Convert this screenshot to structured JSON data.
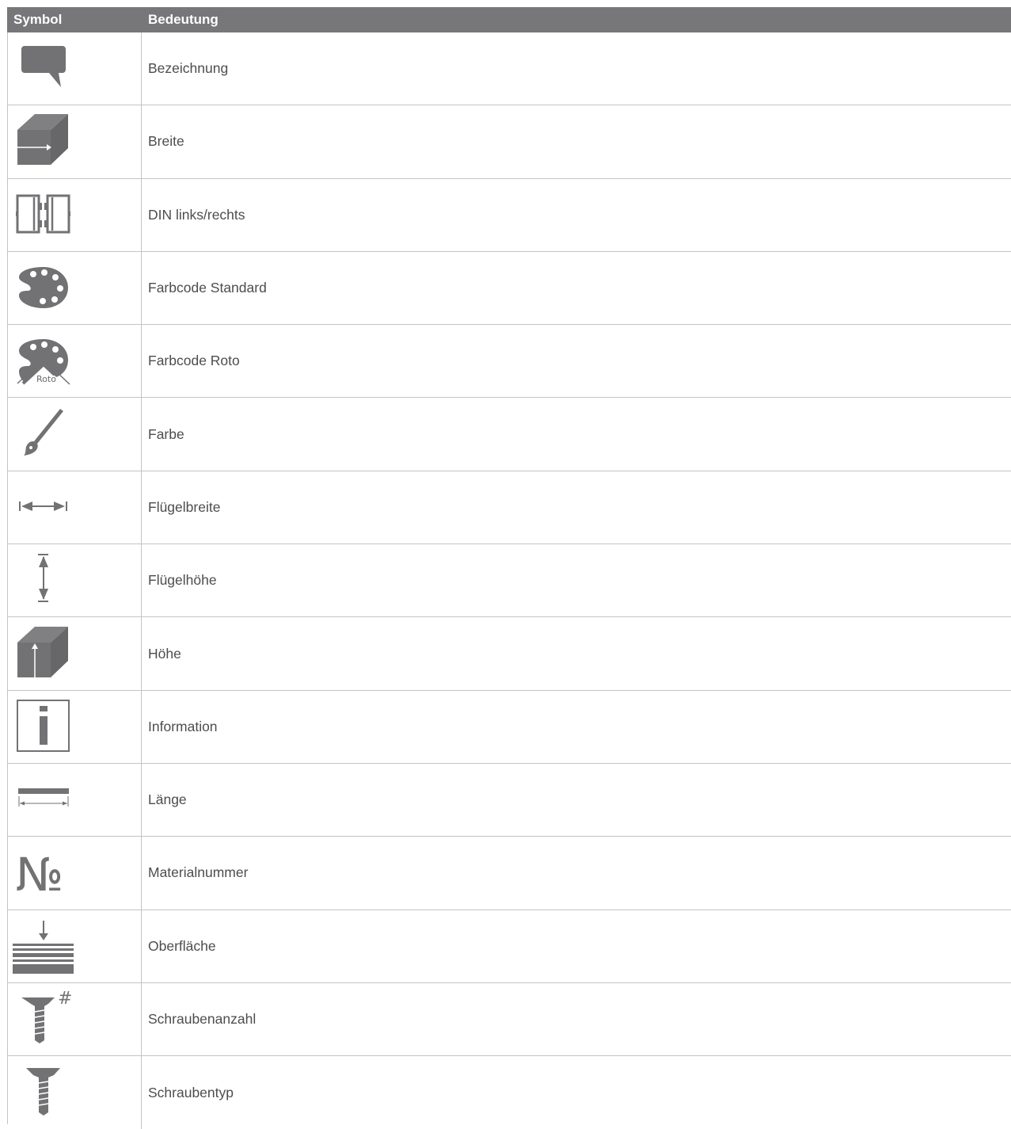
{
  "header": {
    "col_symbol": "Symbol",
    "col_meaning": "Bedeutung"
  },
  "icon_color": "#727275",
  "rows": [
    {
      "icon": "speech-bubble-icon",
      "label": "Bezeichnung"
    },
    {
      "icon": "cube-width-icon",
      "label": "Breite"
    },
    {
      "icon": "din-left-right-icon",
      "label": "DIN links/rechts"
    },
    {
      "icon": "palette-icon",
      "label": "Farbcode Standard"
    },
    {
      "icon": "palette-roto-icon",
      "label": "Farbcode Roto",
      "icon_text": "Roto"
    },
    {
      "icon": "paintbrush-icon",
      "label": "Farbe"
    },
    {
      "icon": "horizontal-arrows-icon",
      "label": "Flügelbreite"
    },
    {
      "icon": "vertical-arrows-icon",
      "label": "Flügelhöhe"
    },
    {
      "icon": "cube-height-icon",
      "label": "Höhe"
    },
    {
      "icon": "info-icon",
      "label": "Information"
    },
    {
      "icon": "length-icon",
      "label": "Länge"
    },
    {
      "icon": "numero-icon",
      "label": "Materialnummer",
      "icon_text": "№"
    },
    {
      "icon": "surface-icon",
      "label": "Oberfläche"
    },
    {
      "icon": "screw-count-icon",
      "label": "Schraubenanzahl",
      "icon_text": "#"
    },
    {
      "icon": "screw-type-icon",
      "label": "Schraubentyp"
    }
  ]
}
